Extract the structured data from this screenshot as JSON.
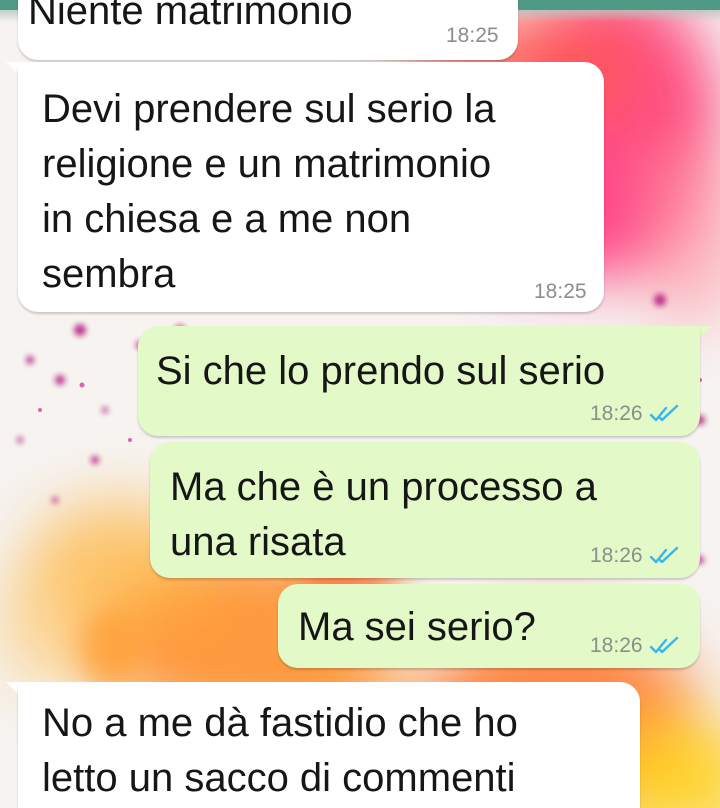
{
  "conversation": {
    "messages": [
      {
        "id": "m1",
        "direction": "incoming",
        "text": "Niente matrimonio",
        "time": "18:25"
      },
      {
        "id": "m2",
        "direction": "incoming",
        "text": "Devi prendere sul serio la\nreligione e un matrimonio\nin chiesa e a me non\nsembra",
        "time": "18:25"
      },
      {
        "id": "m3",
        "direction": "outgoing",
        "text": "Si che lo prendo sul serio",
        "time": "18:26",
        "status": "read-double-check-icon"
      },
      {
        "id": "m4",
        "direction": "outgoing",
        "text": "Ma che è un processo a\nuna risata",
        "time": "18:26",
        "status": "read-double-check-icon"
      },
      {
        "id": "m5",
        "direction": "outgoing",
        "text": "Ma sei serio?",
        "time": "18:26",
        "status": "read-double-check-icon"
      },
      {
        "id": "m6",
        "direction": "incoming",
        "text": "No a me dà fastidio che ho\nletto un sacco di commenti",
        "time": ""
      }
    ]
  },
  "colors": {
    "incoming_bubble": "#ffffff",
    "outgoing_bubble": "#e3f9c8",
    "read_check": "#34b7f1",
    "header_bar": "#4f9a84",
    "wallpaper_base": "#f6f3f1"
  }
}
